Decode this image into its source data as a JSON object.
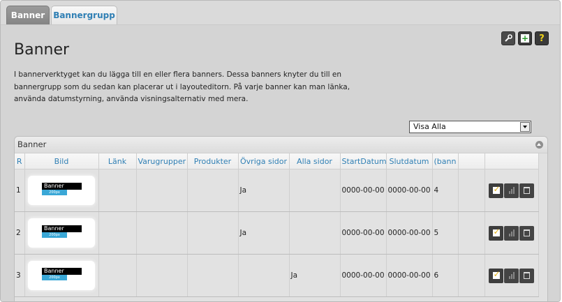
{
  "tabs": [
    {
      "label": "Banner",
      "active": true
    },
    {
      "label": "Bannergrupp",
      "active": false
    }
  ],
  "page": {
    "title": "Banner",
    "description": "I bannerverktyget kan du lägga till en eller flera banners. Dessa banners knyter du till en bannergrupp som du sedan kan placerar ut i layouteditorn. På varje banner kan man länka, använda datumstyrning, använda visningsalternativ med mera."
  },
  "toolbar": {
    "icons": [
      "wrench-icon",
      "add-icon",
      "help-icon"
    ],
    "help_glyph": "?",
    "add_glyph": "+"
  },
  "filter": {
    "selected": "Visa Alla"
  },
  "panel": {
    "title": "Banner"
  },
  "table": {
    "columns": [
      "R",
      "Bild",
      "Länk",
      "Varugrupper",
      "Produkter",
      "Övriga sidor",
      "Alla sidor",
      "StartDatum",
      "Slutdatum",
      "(bann",
      ""
    ],
    "rows": [
      {
        "r": "1",
        "banner_text": "Banner",
        "banner_size": "200px",
        "lank": "",
        "varugrupper": "",
        "produkter": "",
        "ovriga": "Ja",
        "alla": "",
        "start": "0000-00-00",
        "slut": "0000-00-00",
        "bann": "4"
      },
      {
        "r": "2",
        "banner_text": "Banner",
        "banner_size": "200px",
        "lank": "",
        "varugrupper": "",
        "produkter": "",
        "ovriga": "Ja",
        "alla": "",
        "start": "0000-00-00",
        "slut": "0000-00-00",
        "bann": "5"
      },
      {
        "r": "3",
        "banner_text": "Banner",
        "banner_size": "200px",
        "lank": "",
        "varugrupper": "",
        "produkter": "",
        "ovriga": "",
        "alla": "Ja",
        "start": "0000-00-00",
        "slut": "0000-00-00",
        "bann": "6"
      }
    ]
  },
  "colors": {
    "accent": "#2f7fb4",
    "tab_active": "#8e8e8e",
    "background": "#d4d4d4"
  }
}
